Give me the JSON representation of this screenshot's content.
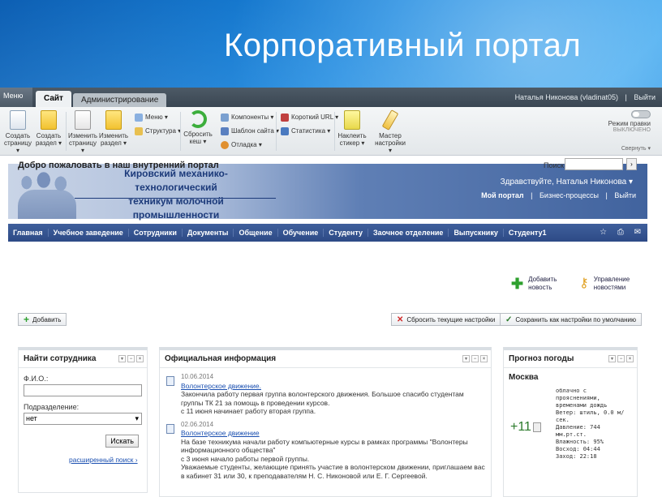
{
  "slide": {
    "title": "Корпоративный портал"
  },
  "panel": {
    "menu_label": "Меню",
    "tabs": [
      "Сайт",
      "Администрирование"
    ],
    "user": "Наталья Никонова (vladinat05)",
    "logout": "Выйти",
    "buttons": [
      {
        "label1": "Создать",
        "label2": "страницу ▾"
      },
      {
        "label1": "Создать",
        "label2": "раздел ▾"
      },
      {
        "label1": "Изменить",
        "label2": "страницу ▾"
      },
      {
        "label1": "Изменить",
        "label2": "раздел ▾"
      }
    ],
    "list1": [
      "Меню ▾",
      "Структура ▾"
    ],
    "reset_cache": {
      "label1": "Сбросить",
      "label2": "кеш ▾"
    },
    "list2": [
      "Компоненты ▾",
      "Шаблон сайта ▾",
      "Отладка ▾"
    ],
    "list3": [
      "Короткий URL ▾",
      "Статистика ▾"
    ],
    "sticker": {
      "label1": "Наклеить",
      "label2": "стикер ▾"
    },
    "wizard": {
      "label1": "Мастер",
      "label2": "настройки ▾"
    },
    "edit_mode": "Режим правки",
    "edit_mode_state": "ВЫКЛЮЧЕНО",
    "collapse": "Свернуть ▾"
  },
  "header": {
    "college_line1": "Кировский механико-технологический",
    "college_line2": "техникум молочной промышленности",
    "greeting": "Здравствуйте, Наталья Никонова ▾",
    "links": [
      "Мой портал",
      "Бизнес-процессы",
      "Выйти"
    ]
  },
  "nav": [
    "Главная",
    "Учебное заведение",
    "Сотрудники",
    "Документы",
    "Общение",
    "Обучение",
    "Студенту",
    "Заочное отделение",
    "Выпускнику",
    "Студенту1"
  ],
  "main": {
    "welcome": "Добро пожаловать в наш внутренний портал",
    "search_label": "Поиск",
    "add_news": [
      "Добавить",
      "новость"
    ],
    "manage_news": [
      "Управление",
      "новостями"
    ],
    "add_button": "Добавить",
    "reset_button": "Сбросить текущие настройки",
    "save_button": "Сохранить как настройки по умолчанию"
  },
  "find_employee": {
    "title": "Найти сотрудника",
    "fio_label": "Ф.И.О.:",
    "dept_label": "Подразделение:",
    "dept_value": "нет",
    "search_button": "Искать",
    "advanced": "расширенный поиск ›"
  },
  "official": {
    "title": "Официальная информация",
    "items": [
      {
        "date": "10.06.2014",
        "title": "Волонтерское движение.",
        "text": [
          "Закончила работу первая группа волонтерского движения. Большое спасибо студентам",
          "группы ТК 21 за помощь в проведении курсов.",
          "с 11 июня начинает работу вторая группа."
        ]
      },
      {
        "date": "02.06.2014",
        "title": "Волонтерское движение",
        "text": [
          "На базе техникума начали работу компьютерные курсы в рамках программы \"Волонтеры",
          "информационного общества\"",
          "с 3 июня начало работы первой группы.",
          "Уважаемые студенты, желающие принять участие в волонтерском движении, приглашаем вас",
          "в кабинет 31 или 30, к преподавателям Н. С. Никоновой или Е. Г. Сергеевой."
        ]
      }
    ]
  },
  "weather": {
    "title": "Прогноз погоды",
    "city": "Москва",
    "temp": "+11",
    "details": [
      "облачно с",
      "прояснениями,",
      "временами дождь",
      "Ветер: штиль, 0.0 м/",
      "сек.",
      "Давление: 744",
      "мм.рт.ст.",
      "Влажность: 95%",
      "Восход: 04:44",
      "Заход: 22:18"
    ]
  }
}
